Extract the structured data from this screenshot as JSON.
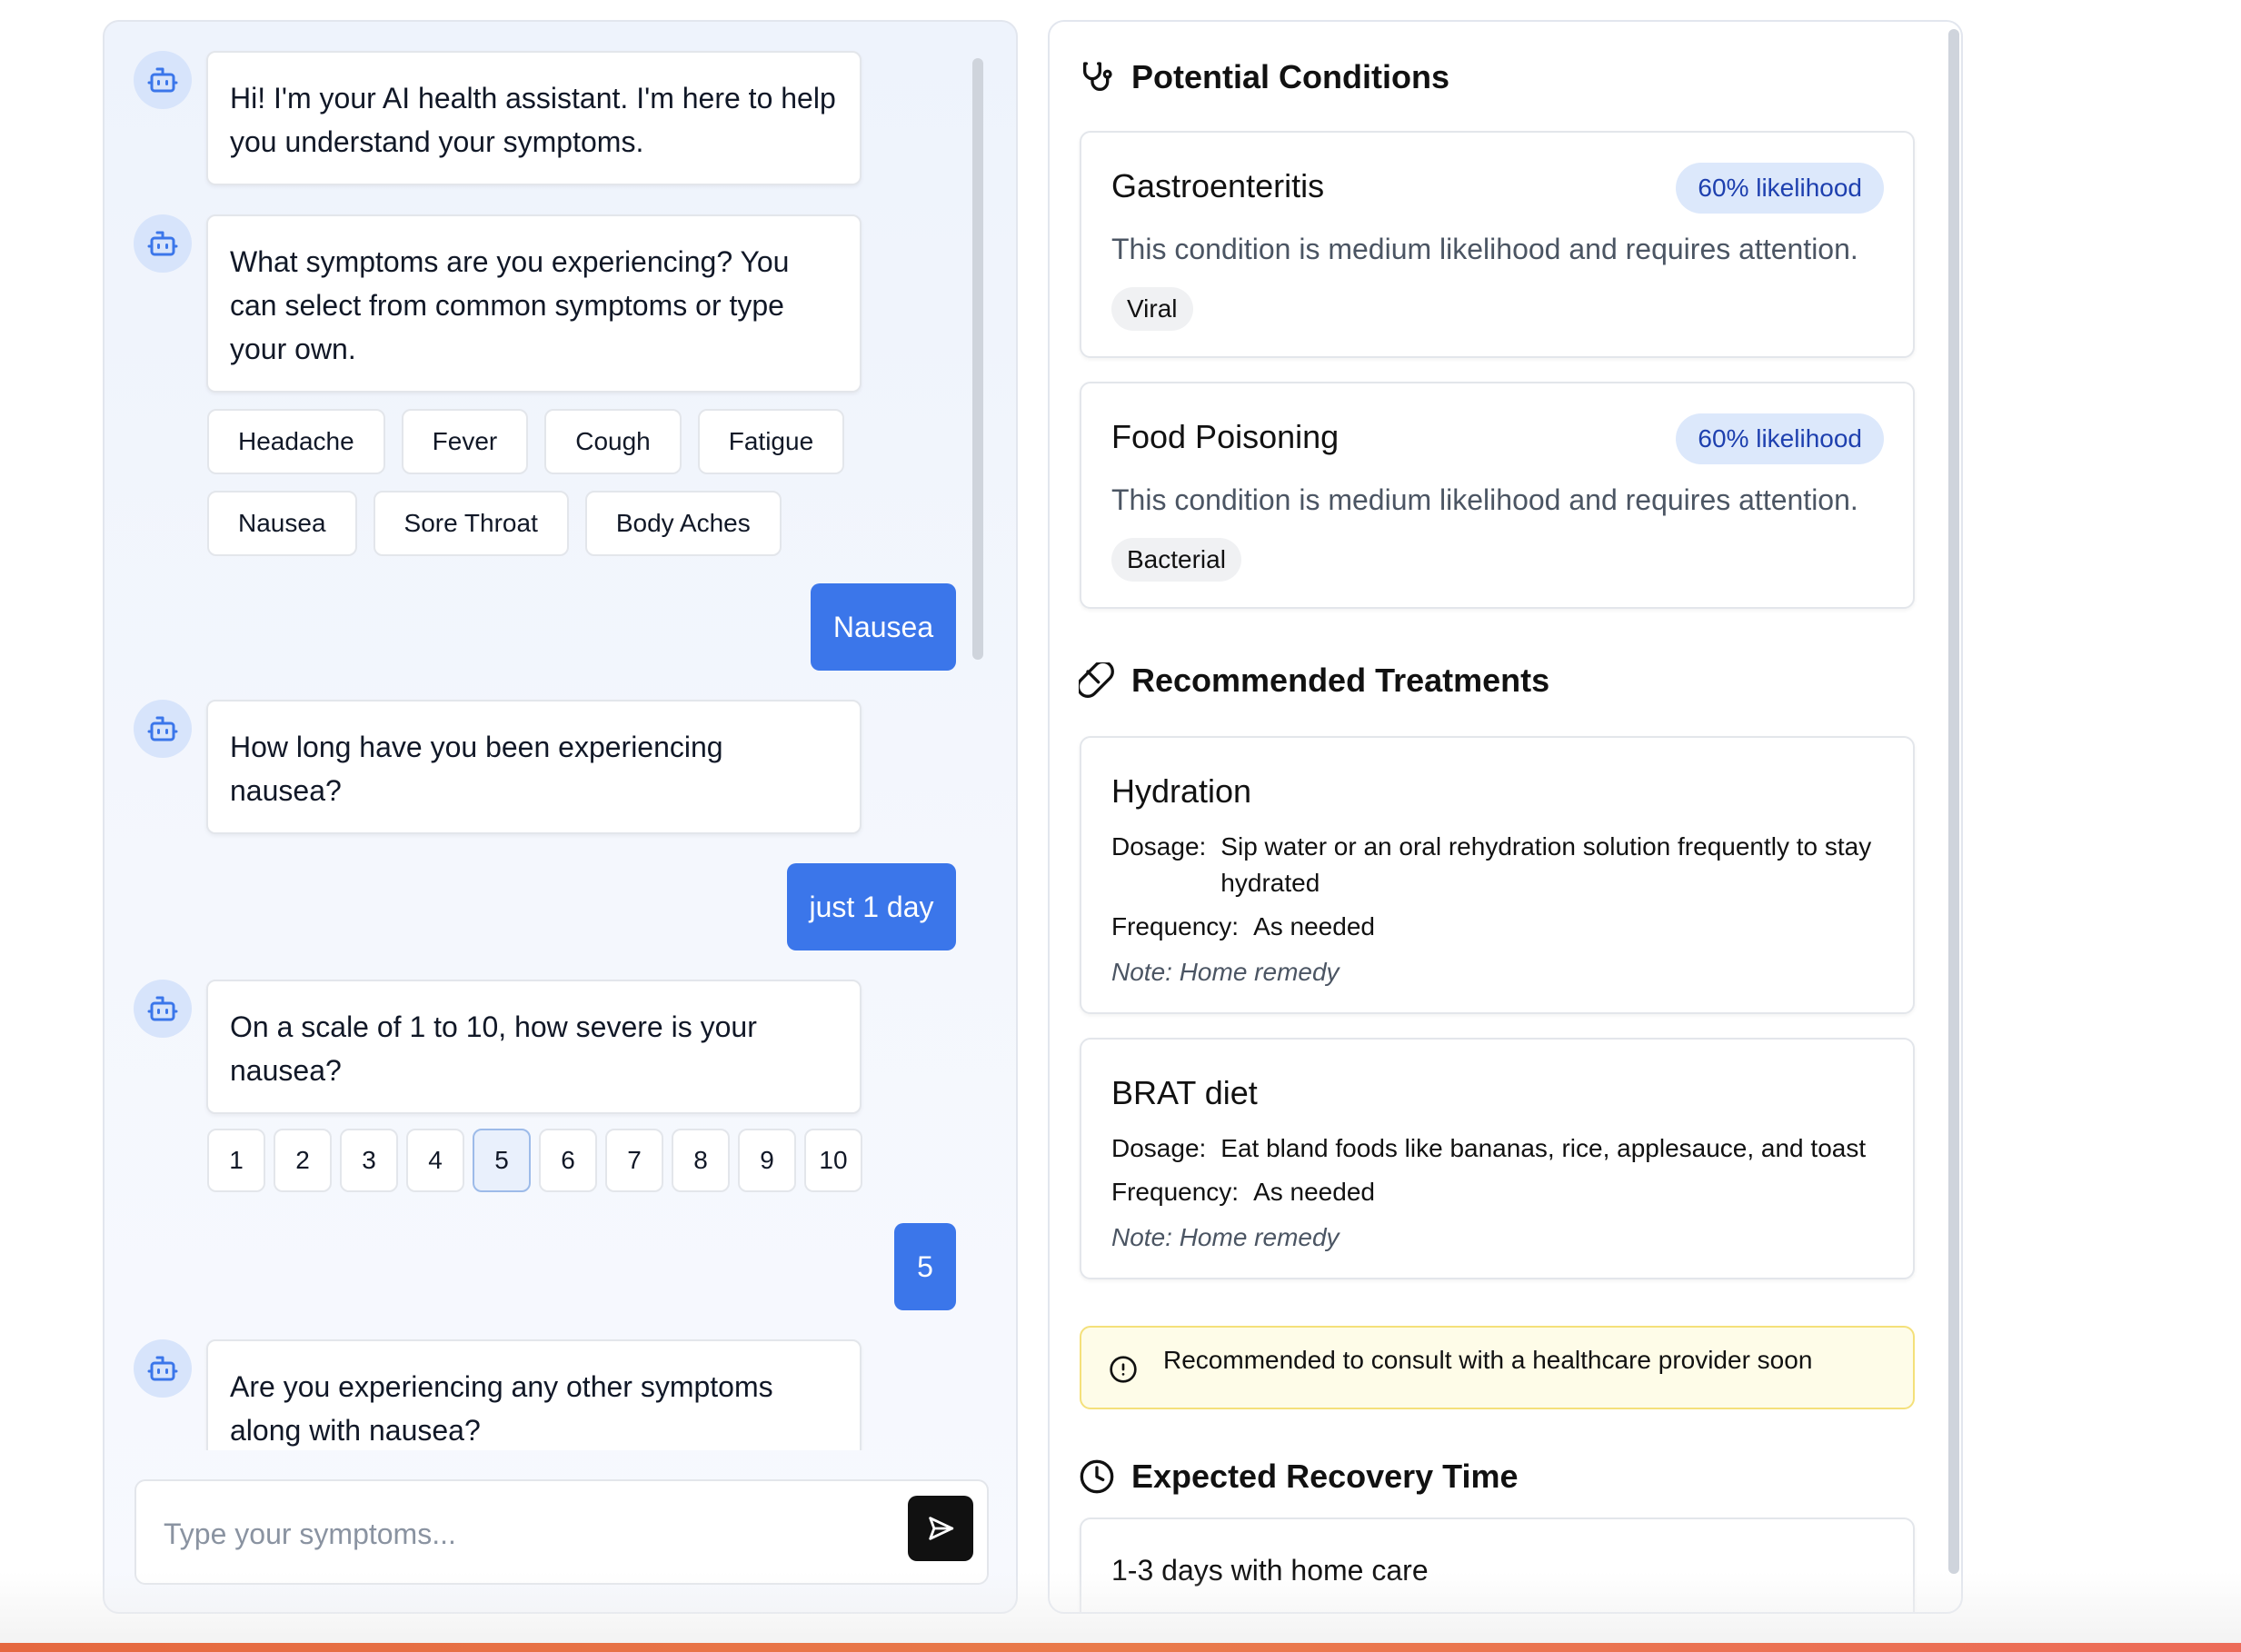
{
  "chat": {
    "messages": [
      {
        "from": "bot",
        "text": "Hi! I'm your AI health assistant. I'm here to help you understand your symptoms."
      },
      {
        "from": "bot",
        "text": "What symptoms are you experiencing? You can select from common symptoms or type your own."
      },
      {
        "from": "user",
        "text": "Nausea"
      },
      {
        "from": "bot",
        "text": "How long have you been experiencing nausea?"
      },
      {
        "from": "user",
        "text": "just 1 day"
      },
      {
        "from": "bot",
        "text": "On a scale of 1 to 10, how severe is your nausea?"
      },
      {
        "from": "user",
        "text": "5"
      },
      {
        "from": "bot",
        "text": "Are you experiencing any other symptoms along with nausea?"
      }
    ],
    "symptom_chips": [
      "Headache",
      "Fever",
      "Cough",
      "Fatigue",
      "Nausea",
      "Sore Throat",
      "Body Aches"
    ],
    "severity_scale": [
      "1",
      "2",
      "3",
      "4",
      "5",
      "6",
      "7",
      "8",
      "9",
      "10"
    ],
    "severity_selected": "5",
    "input": {
      "placeholder": "Type your symptoms...",
      "value": ""
    }
  },
  "results": {
    "conditions_title": "Potential Conditions",
    "conditions": [
      {
        "name": "Gastroenteritis",
        "likelihood": "60% likelihood",
        "description": "This condition is medium likelihood and requires attention.",
        "tag": "Viral"
      },
      {
        "name": "Food Poisoning",
        "likelihood": "60% likelihood",
        "description": "This condition is medium likelihood and requires attention.",
        "tag": "Bacterial"
      }
    ],
    "treatments_title": "Recommended Treatments",
    "treatments": [
      {
        "name": "Hydration",
        "dosage_label": "Dosage:",
        "dosage": "Sip water or an oral rehydration solution frequently to stay hydrated",
        "frequency_label": "Frequency:",
        "frequency": "As needed",
        "note": "Note: Home remedy"
      },
      {
        "name": "BRAT diet",
        "dosage_label": "Dosage:",
        "dosage": "Eat bland foods like bananas, rice, applesauce, and toast",
        "frequency_label": "Frequency:",
        "frequency": "As needed",
        "note": "Note: Home remedy"
      }
    ],
    "alert": "Recommended to consult with a healthcare provider soon",
    "recovery_title": "Expected Recovery Time",
    "recovery_text": "1-3 days with home care"
  },
  "colors": {
    "accent": "#3b76ea",
    "badge_bg": "#dce8fb",
    "badge_text": "#1e40af",
    "alert_bg": "#fefce8",
    "alert_border": "#f4e07a"
  },
  "icons": {
    "bot": "bot-icon",
    "send": "send-icon",
    "conditions": "stethoscope-icon",
    "treatments": "pill-icon",
    "alert": "alert-circle-icon",
    "recovery": "clock-icon"
  }
}
